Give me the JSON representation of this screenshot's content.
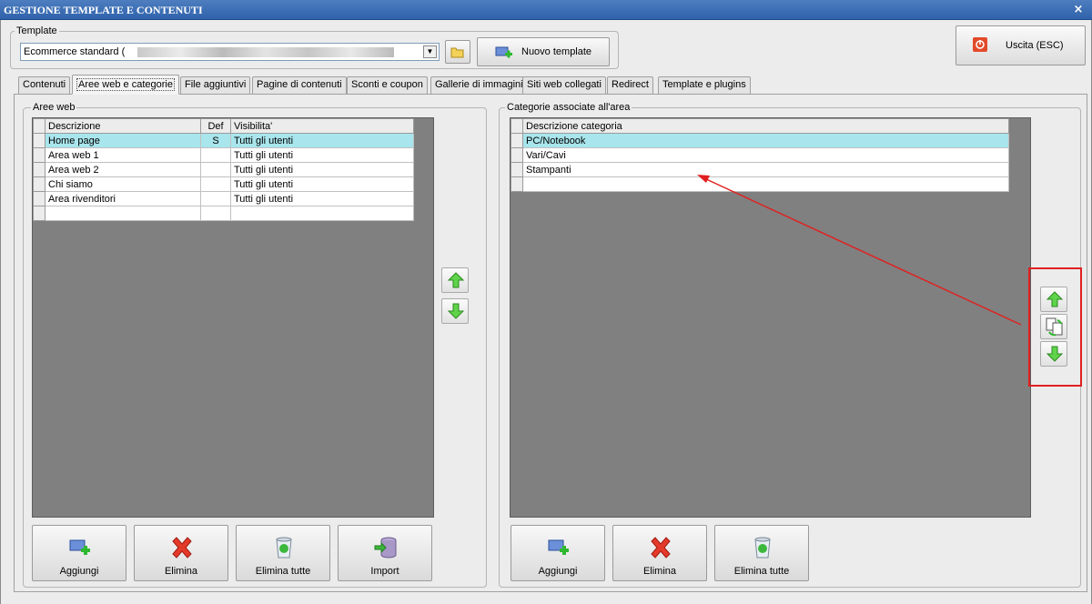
{
  "window": {
    "title": "GESTIONE TEMPLATE E CONTENUTI",
    "close_glyph": "×"
  },
  "template": {
    "legend": "Template",
    "selected": "Ecommerce standard (",
    "new_button": "Nuovo template"
  },
  "exit_button": "Uscita (ESC)",
  "tabs": [
    {
      "label": "Contenuti",
      "active": false
    },
    {
      "label": "Aree web e categorie",
      "active": true
    },
    {
      "label": "File aggiuntivi",
      "active": false
    },
    {
      "label": "Pagine di contenuti",
      "active": false
    },
    {
      "label": "Sconti e coupon",
      "active": false
    },
    {
      "label": "Gallerie di immagini",
      "active": false
    },
    {
      "label": "Siti web collegati",
      "active": false
    },
    {
      "label": "Redirect",
      "active": false
    },
    {
      "label": "Template e plugins",
      "active": false
    }
  ],
  "aree_web": {
    "legend": "Aree web",
    "columns": [
      "Descrizione",
      "Def",
      "Visibilita'"
    ],
    "rows": [
      [
        "Home page",
        "S",
        "Tutti gli utenti"
      ],
      [
        "Area web 1",
        "",
        "Tutti gli utenti"
      ],
      [
        "Area web 2",
        "",
        "Tutti gli utenti"
      ],
      [
        "Chi siamo",
        "",
        "Tutti gli utenti"
      ],
      [
        "Area rivenditori",
        "",
        "Tutti gli utenti"
      ]
    ],
    "buttons": {
      "add": "Aggiungi",
      "delete": "Elimina",
      "delete_all": "Elimina tutte",
      "import": "Import"
    }
  },
  "categorie": {
    "legend": "Categorie associate all'area",
    "columns": [
      "Descrizione categoria"
    ],
    "rows": [
      "PC/Notebook",
      "Vari/Cavi",
      "Stampanti"
    ],
    "buttons": {
      "add": "Aggiungi",
      "delete": "Elimina",
      "delete_all": "Elimina tutte"
    }
  },
  "colors": {
    "selected_row": "#a9e5ec",
    "grid_bg": "#808080",
    "highlight": "#e02020",
    "title_bar": "#3a6cb4"
  }
}
